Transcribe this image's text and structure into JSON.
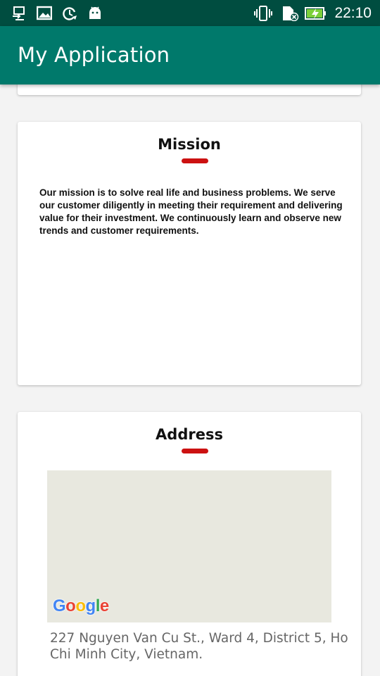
{
  "status_bar": {
    "time": "22:10",
    "left_icons": [
      "usb-transfer-icon",
      "image-icon",
      "sync-icon",
      "android-icon"
    ],
    "right_icons": [
      "vibrate-icon",
      "sd-card-icon",
      "battery-charging-icon"
    ]
  },
  "app_bar": {
    "title": "My Application",
    "background": "#00796b"
  },
  "mission": {
    "title": "Mission",
    "body": "Our mission is to solve real life and business problems. We serve our customer diligently in meeting their requirement and delivering value for their investment. We continuously learn and observe new trends and customer requirements."
  },
  "address": {
    "title": "Address",
    "map_logo": "Google",
    "text": "227 Nguyen Van Cu St., Ward 4, District 5, Ho Chi Minh City, Vietnam."
  },
  "colors": {
    "accent": "#cc1111",
    "status_bar": "#004d40",
    "app_bar": "#00796b"
  }
}
